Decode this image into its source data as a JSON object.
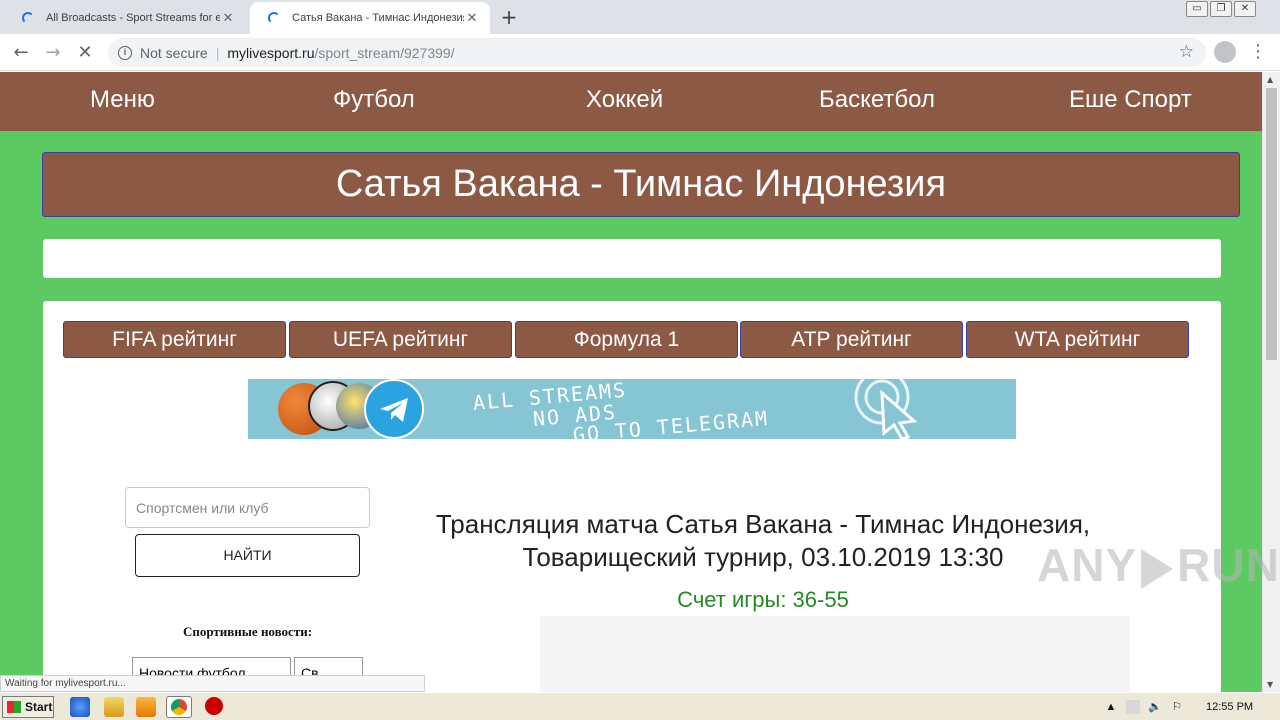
{
  "browser": {
    "tabs": [
      {
        "title": "All Broadcasts - Sport Streams for ea",
        "state": "inactive"
      },
      {
        "title": "Сатья Вакана - Тимнас Индонезия",
        "state": "active-loading"
      }
    ],
    "close_glyph": "✕",
    "new_tab_glyph": "+",
    "address": {
      "security": "Not secure",
      "separator": "|",
      "host": "mylivesport.ru",
      "path": "/sport_stream/927399/"
    },
    "window_controls": [
      "▭",
      "❐",
      "✕"
    ],
    "back_glyph": "←",
    "forward_glyph": "→",
    "stop_glyph": "✕",
    "star_glyph": "☆",
    "menu_glyph": "⋮",
    "info_glyph": "i"
  },
  "nav": {
    "items": [
      "Меню",
      "Футбол",
      "Хоккей",
      "Баскетбол",
      "Еше Спорт"
    ]
  },
  "banner": {
    "title": "Сатья Вакана - Тимнас Индонезия"
  },
  "ratings": [
    "FIFA рейтинг",
    "UEFA рейтинг",
    "Формула 1",
    "ATP рейтинг",
    "WTA рейтинг"
  ],
  "telegram_ad": {
    "line1": "ALL STREAMS",
    "line2": "NO ADS",
    "line3": "GO TO TELEGRAM"
  },
  "search": {
    "placeholder": "Спортсмен или клуб",
    "button": "НАЙТИ"
  },
  "news": {
    "title": "Спортивные новости:",
    "tab1": "Новости футбол",
    "tab2": "Св"
  },
  "stream": {
    "title_line1": "Трансляция матча Сатья Вакана - Тимнас Индонезия,",
    "title_line2": "Товарищеский турнир, 03.10.2019 13:30",
    "score": "Счет игры: 36-55"
  },
  "status_bar": "Waiting for mylivesport.ru...",
  "watermark": {
    "left": "ANY",
    "right": "RUN"
  },
  "taskbar": {
    "start": "Start",
    "clock": "12:55 PM"
  },
  "colors": {
    "page_green": "#5dc963",
    "brown": "#8c5944",
    "score_green": "#228b22",
    "telegram_blue": "#86c5d3"
  }
}
